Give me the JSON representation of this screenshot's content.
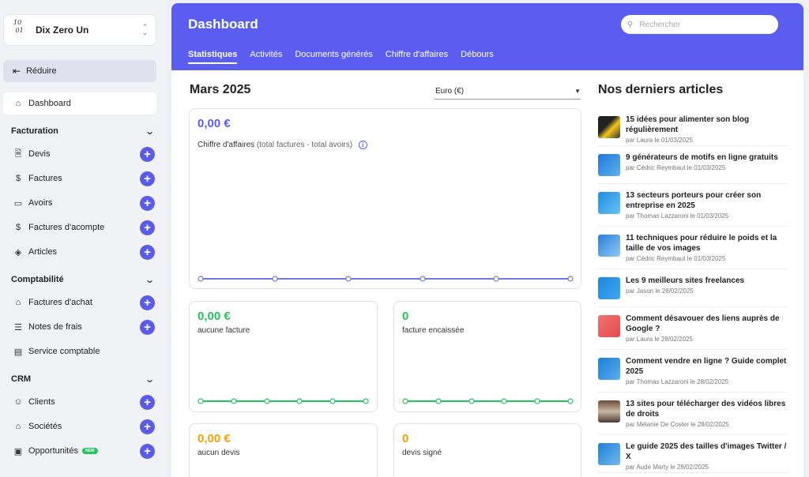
{
  "sidebar": {
    "company": "Dix Zero Un",
    "logo_text": "10 01",
    "reduce": "Réduire",
    "dashboard": "Dashboard",
    "sections": {
      "facturation": "Facturation",
      "comptabilite": "Comptabilité",
      "crm": "CRM"
    },
    "facturation_items": [
      "Devis",
      "Factures",
      "Avoirs",
      "Factures d'acompte",
      "Articles"
    ],
    "comptabilite_items": [
      "Factures d'achat",
      "Notes de frais",
      "Service comptable"
    ],
    "crm_items": [
      "Clients",
      "Sociétés",
      "Opportunités"
    ],
    "new_badge": "NEW"
  },
  "header": {
    "title": "Dashboard",
    "search_placeholder": "Rechercher",
    "tabs": [
      "Statistiques",
      "Activités",
      "Documents générés",
      "Chiffre d'affaires",
      "Débours"
    ],
    "active_tab": "Statistiques"
  },
  "main": {
    "month": "Mars 2025",
    "currency": "Euro (€)",
    "revenue": {
      "value": "0,00 €",
      "label": "Chiffre d'affaires",
      "sub": "(total factures - total avoirs)"
    },
    "cards": [
      {
        "value": "0,00 €",
        "label": "aucune facture"
      },
      {
        "value": "0",
        "label": "facture encaissée"
      },
      {
        "value": "0,00 €",
        "label": "aucun devis"
      },
      {
        "value": "0",
        "label": "devis signé"
      }
    ]
  },
  "articles": {
    "title": "Nos derniers articles",
    "items": [
      {
        "title": "15 idées pour alimenter son blog régulièrement",
        "meta": "par Laura le 01/03/2025"
      },
      {
        "title": "9 générateurs de motifs en ligne gratuits",
        "meta": "par Cédric Reymbaut le 01/03/2025"
      },
      {
        "title": "13 secteurs porteurs pour créer son entreprise en 2025",
        "meta": "par Thomas Lazzaroni le 01/03/2025"
      },
      {
        "title": "11 techniques pour réduire le poids et la taille de vos images",
        "meta": "par Cédric Reymbaut le 01/03/2025"
      },
      {
        "title": "Les 9 meilleurs sites freelances",
        "meta": "par Jason le 28/02/2025"
      },
      {
        "title": "Comment désavouer des liens auprès de Google ?",
        "meta": "par Laura le 28/02/2025"
      },
      {
        "title": "Comment vendre en ligne ? Guide complet 2025",
        "meta": "par Thomas Lazzaroni le 28/02/2025"
      },
      {
        "title": "13 sites pour télécharger des vidéos libres de droits",
        "meta": "par Mélanie De Coster le 28/02/2025"
      },
      {
        "title": "Le guide 2025 des tailles d'images Twitter / X",
        "meta": "par Aude Marty le 28/02/2025"
      }
    ]
  },
  "colors": {
    "accent": "#5b5cf0",
    "green": "#22c55e",
    "orange": "#f59e0b"
  }
}
